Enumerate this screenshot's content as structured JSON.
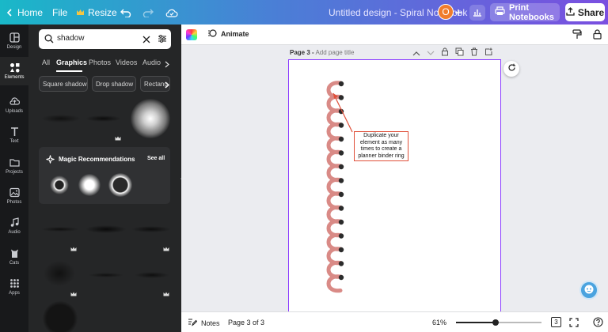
{
  "topbar": {
    "home_label": "Home",
    "file_label": "File",
    "resize_label": "Resize",
    "doc_title": "Untitled design - Spiral Notebook",
    "avatar_initial": "O",
    "print_label": "Print Notebooks",
    "share_label": "Share"
  },
  "rail": {
    "items": [
      {
        "label": "Design",
        "icon": "design-icon"
      },
      {
        "label": "Elements",
        "icon": "elements-icon"
      },
      {
        "label": "Uploads",
        "icon": "upload-icon"
      },
      {
        "label": "Text",
        "icon": "text-icon"
      },
      {
        "label": "Projects",
        "icon": "folder-icon"
      },
      {
        "label": "Photos",
        "icon": "photo-icon"
      },
      {
        "label": "Audio",
        "icon": "music-icon"
      },
      {
        "label": "Cats",
        "icon": "cat-icon"
      },
      {
        "label": "Apps",
        "icon": "apps-icon"
      }
    ]
  },
  "panel": {
    "search_value": "shadow",
    "tabs": [
      "All",
      "Graphics",
      "Photos",
      "Videos",
      "Audio"
    ],
    "active_tab": "Graphics",
    "chips": [
      "Square shadow",
      "Drop shadow",
      "Rectang"
    ],
    "magic_title": "Magic Recommendations",
    "see_all": "See all"
  },
  "editor": {
    "animate_label": "Animate",
    "page_label": "Page 3 -",
    "page_title_placeholder": "Add page title",
    "annotation": "Duplicate your element as many times to create a planner binder ring",
    "ring_color": "#d98a86",
    "accent_color": "#8b3dff"
  },
  "bottombar": {
    "notes_label": "Notes",
    "page_indicator": "Page 3 of 3",
    "zoom": "61%",
    "page_count_badge": "3"
  }
}
